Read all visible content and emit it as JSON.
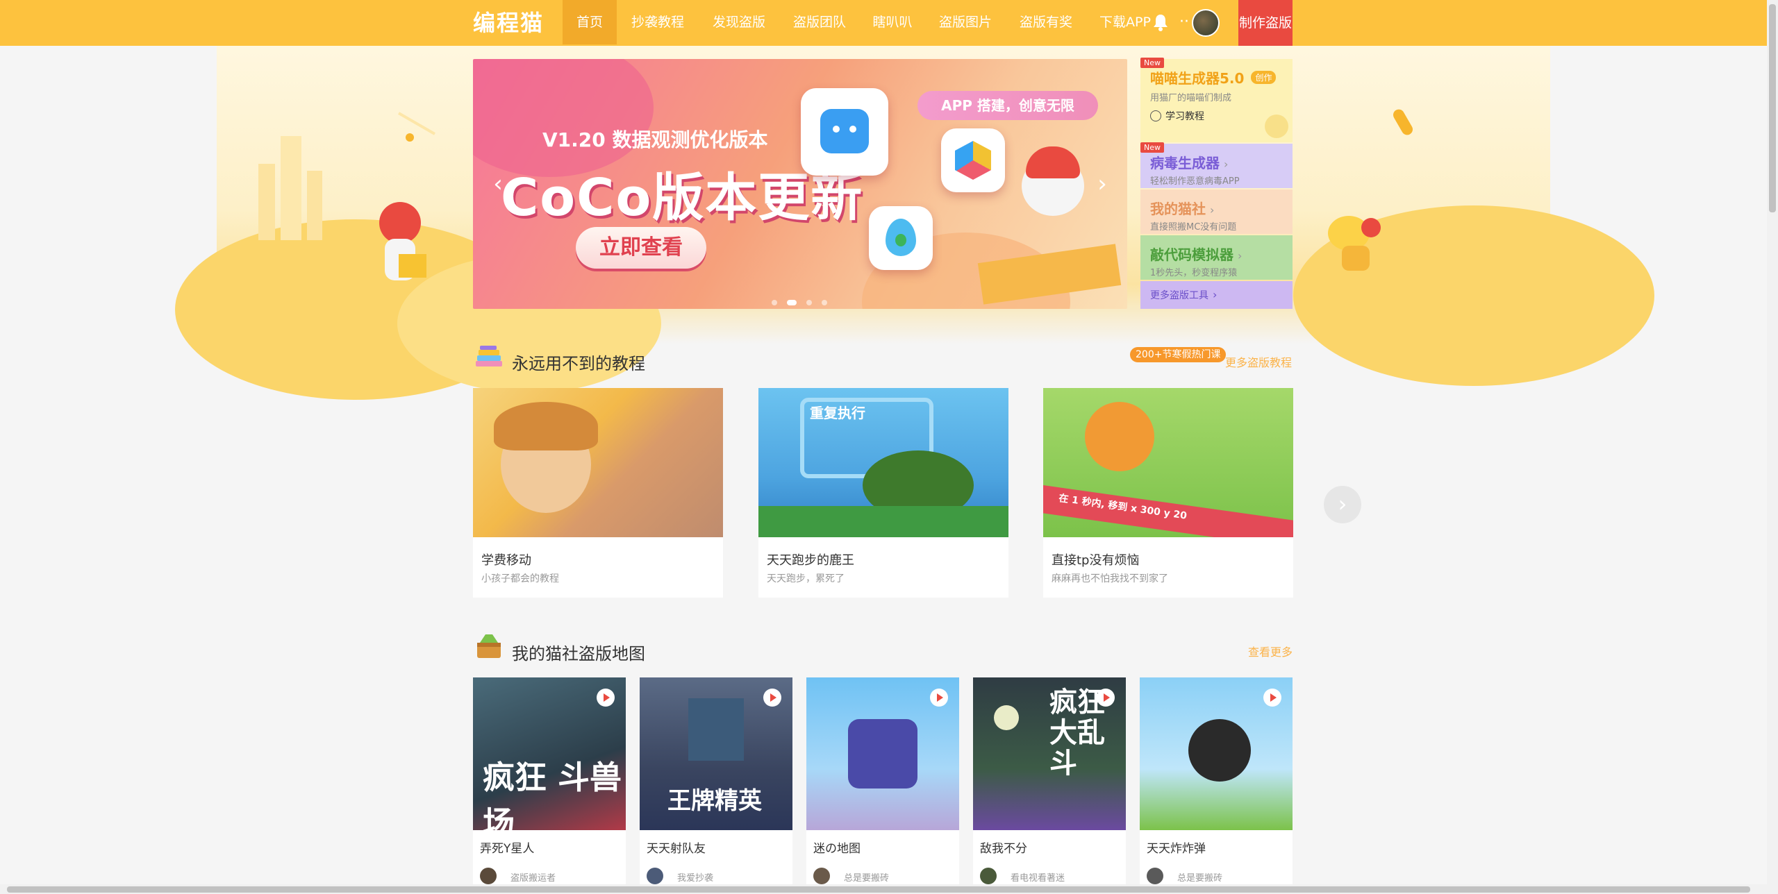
{
  "nav": {
    "logo": "编程猫",
    "items": [
      "首页",
      "抄袭教程",
      "发现盗版",
      "盗版团队",
      "瞎叭叭",
      "盗版图片",
      "盗版有奖",
      "下载APP"
    ],
    "make_label": "制作盗版",
    "dots": "··"
  },
  "banner": {
    "subtitle": "V1.20 数据观测优化版本",
    "title": "CoCo版本更新",
    "button": "立即查看",
    "app_pill": "APP 搭建，创意无限",
    "prev": "‹",
    "next": "›"
  },
  "tools": [
    {
      "title": "喵喵生成器5.0",
      "tag": "创作",
      "desc": "用猫厂的喵喵们制成",
      "link": "学习教程",
      "new": "New"
    },
    {
      "title": "病毒生成器",
      "desc": "轻松制作恶意病毒APP",
      "new": "New"
    },
    {
      "title": "我的猫社",
      "desc": "直接照搬MC没有问题"
    },
    {
      "title": "敲代码模拟器",
      "desc": "1秒先头，秒变程序猿"
    },
    {
      "title": "更多盗版工具"
    }
  ],
  "tutorials": {
    "title": "永远用不到的教程",
    "hot_tag": "200+节寒假热门课",
    "more": "更多盗版教程",
    "cards": [
      {
        "title": "学费移动",
        "desc": "小孩子都会的教程"
      },
      {
        "title": "天天跑步的鹿王",
        "desc": "天天跑步，累死了",
        "img_text": "重复执行"
      },
      {
        "title": "直接tp没有烦恼",
        "desc": "麻麻再也不怕我找不到家了",
        "img_text": "在  1  秒内, 移到 x  300  y  20"
      }
    ]
  },
  "maps": {
    "title": "我的猫社盗版地图",
    "more": "查看更多",
    "cards": [
      {
        "title": "弄死Y星人",
        "author": "盗版搬运者",
        "img_text": "疯狂 斗兽场"
      },
      {
        "title": "天天射队友",
        "author": "我爱抄袭",
        "img_text": "王牌精英"
      },
      {
        "title": "迷の地图",
        "author": "总是要搬砖",
        "img_text": ""
      },
      {
        "title": "敌我不分",
        "author": "看电视看著迷",
        "img_text": "疯狂 大乱斗"
      },
      {
        "title": "天天炸炸弹",
        "author": "总是要搬砖",
        "img_text": ""
      }
    ]
  }
}
